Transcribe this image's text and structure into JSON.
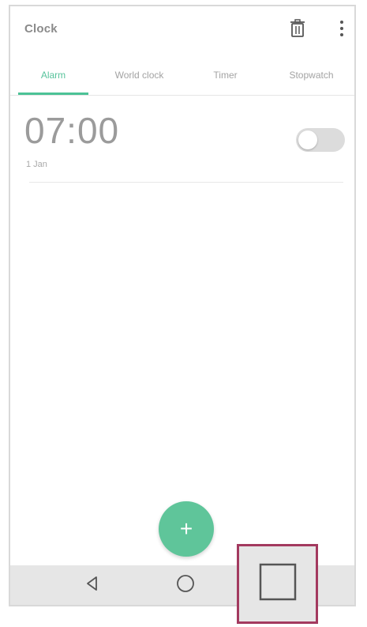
{
  "app_bar": {
    "title": "Clock",
    "delete_icon": "trash-icon",
    "more_icon": "more-vert-icon"
  },
  "tabs": [
    {
      "label": "Alarm",
      "active": true
    },
    {
      "label": "World clock",
      "active": false
    },
    {
      "label": "Timer",
      "active": false
    },
    {
      "label": "Stopwatch",
      "active": false
    }
  ],
  "alarm": {
    "time": "07:00",
    "subtitle": "1 Jan",
    "enabled": false
  },
  "fab": {
    "label": "+",
    "icon": "add-icon"
  },
  "nav": {
    "back_icon": "back-triangle-icon",
    "home_icon": "home-circle-icon",
    "recents_icon": "recent-apps-square-icon"
  },
  "colors": {
    "accent": "#4cc296",
    "highlight": "#a33a5f"
  }
}
